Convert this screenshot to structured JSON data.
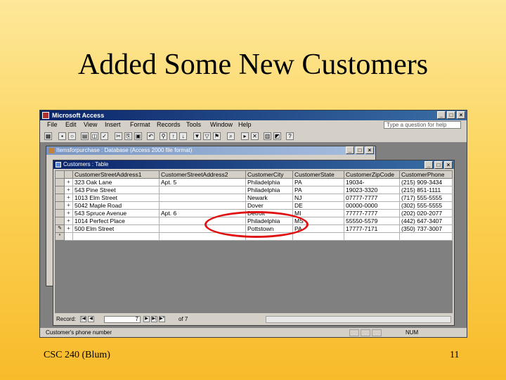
{
  "slide": {
    "title": "Added Some New Customers",
    "footer_left": "CSC 240 (Blum)",
    "footer_right": "11"
  },
  "app": {
    "title": "Microsoft Access",
    "menus": [
      "File",
      "Edit",
      "View",
      "Insert",
      "Format",
      "Records",
      "Tools",
      "Window",
      "Help"
    ],
    "help_placeholder": "Type a question for help"
  },
  "db_window": {
    "title": "Itemsforpurchase : Database (Access 2000 file format)"
  },
  "table_window": {
    "title": "Customers : Table",
    "columns": [
      "CustomerStreetAddress1",
      "CustomerStreetAddress2",
      "CustomerCity",
      "CustomerState",
      "CustomerZipCode",
      "CustomerPhone"
    ],
    "rows": [
      {
        "selector": "",
        "expand": "+",
        "cells": [
          "323 Oak Lane",
          "Apt. 5",
          "Philadelphia",
          "PA",
          "19034-",
          "(215) 909-3434"
        ]
      },
      {
        "selector": "",
        "expand": "+",
        "cells": [
          "543 Pine Street",
          "",
          "Philadelphia",
          "PA",
          "19023-3320",
          "(215) 851-1111"
        ]
      },
      {
        "selector": "",
        "expand": "+",
        "cells": [
          "1013 Elm Street",
          "",
          "Newark",
          "NJ",
          "07777-7777",
          "(717) 555-5555"
        ]
      },
      {
        "selector": "",
        "expand": "+",
        "cells": [
          "5042 Maple Road",
          "",
          "Dover",
          "DE",
          "00000-0000",
          "(302) 555-5555"
        ]
      },
      {
        "selector": "",
        "expand": "+",
        "cells": [
          "543 Spruce Avenue",
          "Apt. 6",
          "Detroit",
          "MI",
          "77777-7777",
          "(202) 020-2077"
        ]
      },
      {
        "selector": "",
        "expand": "+",
        "cells": [
          "1014 Perfect Place",
          "",
          "Philadelphia",
          "MS",
          "55550-5579",
          "(442) 647-3407"
        ]
      },
      {
        "selector": "✎",
        "expand": "+",
        "cells": [
          "500 Elm Street",
          "",
          "Pottstown",
          "PA",
          "17777-7171",
          "(350) 737-3007"
        ]
      },
      {
        "selector": "*",
        "expand": "",
        "cells": [
          "",
          "",
          "",
          "",
          "",
          ""
        ]
      }
    ],
    "nav": {
      "label": "Record:",
      "current": "7",
      "of_text": "of  7"
    }
  },
  "status": {
    "text": "Customer's phone number",
    "num": "NUM"
  },
  "colors": {
    "highlight": "#e01010",
    "title_blue": "#0a246a"
  }
}
